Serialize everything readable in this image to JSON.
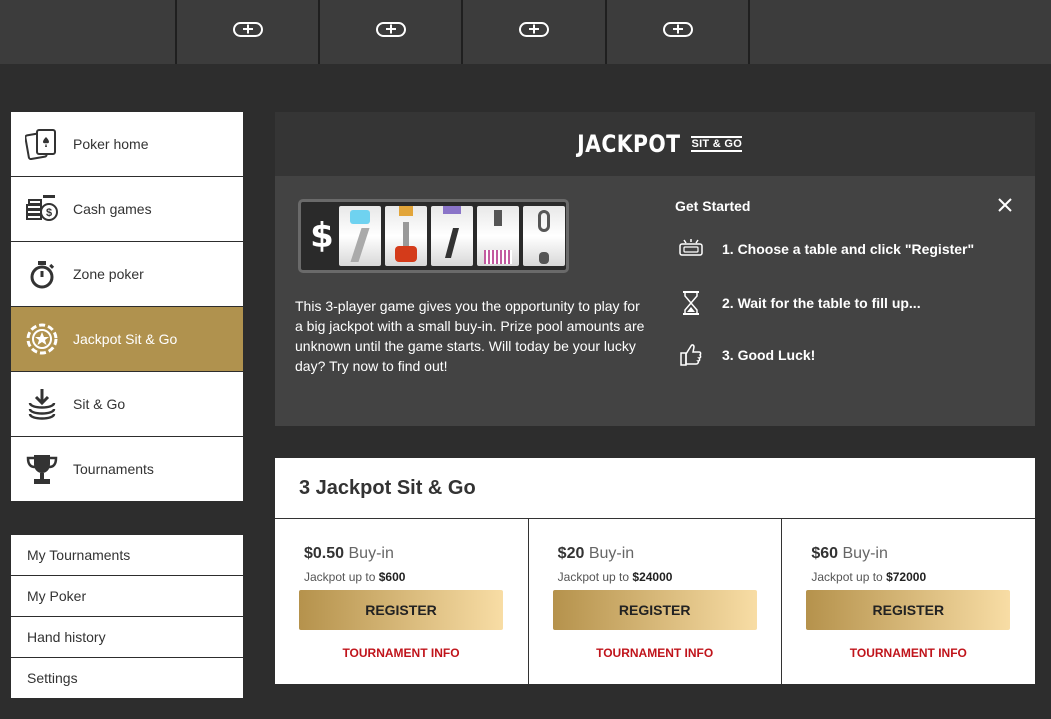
{
  "topbar": {
    "slots": [
      "plus-icon",
      "plus-icon",
      "plus-icon",
      "plus-icon"
    ]
  },
  "nav": {
    "items": [
      {
        "label": "Poker home",
        "icon": "cards-icon"
      },
      {
        "label": "Cash games",
        "icon": "coins-icon"
      },
      {
        "label": "Zone poker",
        "icon": "stopwatch-icon"
      },
      {
        "label": "Jackpot Sit & Go",
        "icon": "poker-chip-icon",
        "active": true
      },
      {
        "label": "Sit & Go",
        "icon": "sit-go-icon"
      },
      {
        "label": "Tournaments",
        "icon": "trophy-icon"
      }
    ]
  },
  "nav2": {
    "items": [
      "My Tournaments",
      "My Poker",
      "Hand history",
      "Settings"
    ]
  },
  "hero": {
    "logo_main": "JACKPOT",
    "logo_sub": "SIT & GO",
    "reel_symbol": "$",
    "description": "This 3-player game gives you the opportunity to play for a big jackpot with a small buy-in. Prize pool amounts are unknown until the game starts. Will today be your lucky day? Try now to find out!",
    "get_started": "Get Started",
    "steps": [
      {
        "text": "1. Choose a table and click \"Register\"",
        "icon": "ticket-icon"
      },
      {
        "text": "2. Wait for the table to fill up...",
        "icon": "hourglass-icon"
      },
      {
        "text": "3. Good Luck!",
        "icon": "thumbs-up-icon"
      }
    ]
  },
  "jackpot": {
    "title": "3 Jackpot Sit & Go",
    "cards": [
      {
        "price": "$0.50",
        "buyin": "Buy-in",
        "jackpot_prefix": "Jackpot up to",
        "jackpot": "$600",
        "register": "REGISTER",
        "info": "TOURNAMENT INFO"
      },
      {
        "price": "$20",
        "buyin": "Buy-in",
        "jackpot_prefix": "Jackpot up to",
        "jackpot": "$24000",
        "register": "REGISTER",
        "info": "TOURNAMENT INFO"
      },
      {
        "price": "$60",
        "buyin": "Buy-in",
        "jackpot_prefix": "Jackpot up to",
        "jackpot": "$72000",
        "register": "REGISTER",
        "info": "TOURNAMENT INFO"
      }
    ]
  },
  "colors": {
    "accent": "#b0924e",
    "link": "#c0141b",
    "background": "#2d2d2d"
  }
}
